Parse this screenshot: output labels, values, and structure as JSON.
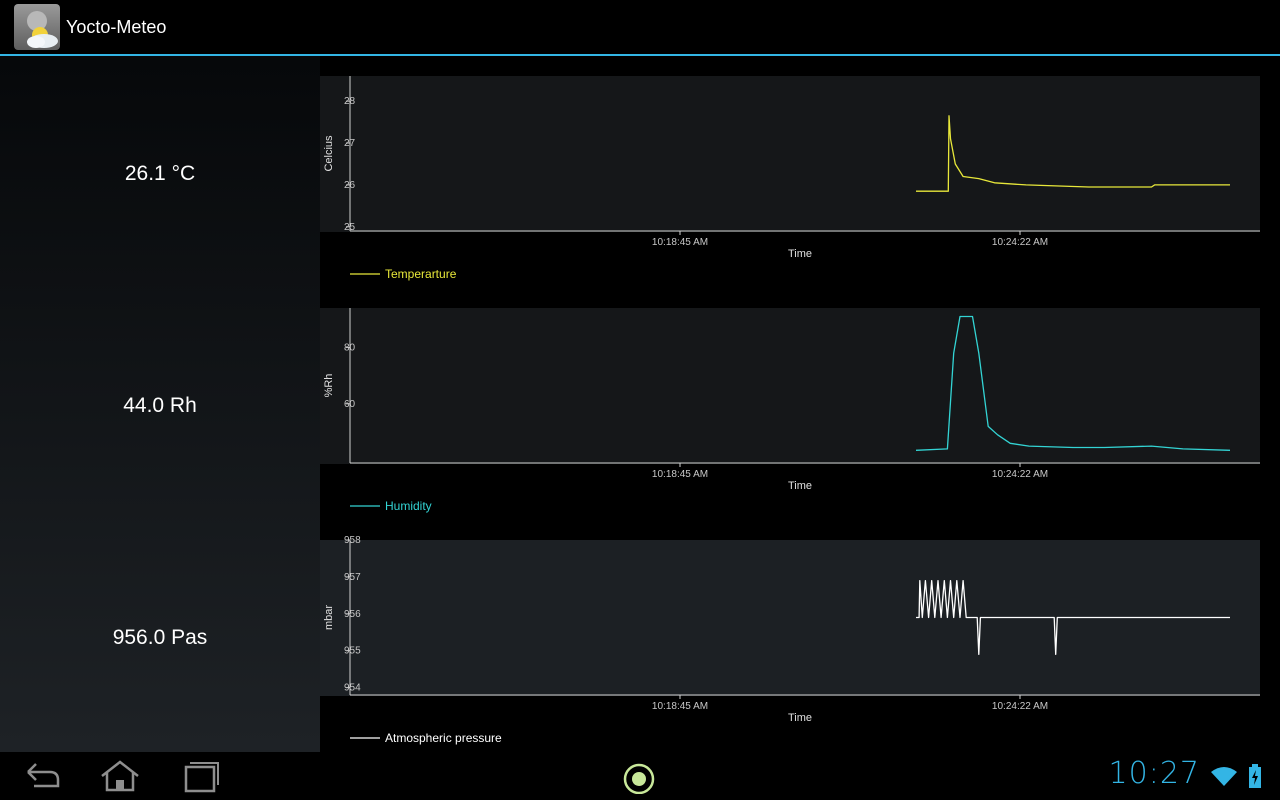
{
  "app": {
    "title": "Yocto-Meteo"
  },
  "readings": [
    {
      "value": "26.1 °C"
    },
    {
      "value": "44.0 Rh"
    },
    {
      "value": "956.0 Pas"
    }
  ],
  "charts": [
    {
      "id": "temperature",
      "ylabel": "Celcius",
      "xlabel": "Time",
      "legend": "Temperarture",
      "color": "#e8e83a",
      "yticks": [
        "28",
        "27",
        "26",
        "25"
      ],
      "xticks": [
        "10:18:45 AM",
        "10:24:22 AM"
      ]
    },
    {
      "id": "humidity",
      "ylabel": "%Rh",
      "xlabel": "Time",
      "legend": "Humidity",
      "color": "#33d4d4",
      "yticks": [
        "80",
        "60"
      ],
      "xticks": [
        "10:18:45 AM",
        "10:24:22 AM"
      ]
    },
    {
      "id": "pressure",
      "ylabel": "mbar",
      "xlabel": "Time",
      "legend": "Atmospheric pressure",
      "color": "#ffffff",
      "yticks": [
        "958",
        "957",
        "956",
        "955",
        "954"
      ],
      "xticks": [
        "10:18:45 AM",
        "10:24:22 AM"
      ]
    }
  ],
  "chart_data": [
    {
      "type": "line",
      "ylabel": "Celcius",
      "xlabel": "Time",
      "ylim": [
        24.9,
        28.6
      ],
      "series": [
        {
          "name": "Temperarture",
          "points": [
            [
              0,
              25.85
            ],
            [
              0.103,
              25.85
            ],
            [
              0.105,
              27.65
            ],
            [
              0.11,
              27.1
            ],
            [
              0.125,
              26.5
            ],
            [
              0.15,
              26.2
            ],
            [
              0.2,
              26.15
            ],
            [
              0.25,
              26.05
            ],
            [
              0.35,
              26.0
            ],
            [
              0.55,
              25.95
            ],
            [
              0.75,
              25.95
            ],
            [
              0.76,
              26.0
            ],
            [
              1,
              26.0
            ]
          ]
        }
      ],
      "xticks": [
        "10:18:45 AM",
        "10:24:22 AM"
      ]
    },
    {
      "type": "line",
      "ylabel": "%Rh",
      "xlabel": "Time",
      "ylim": [
        39,
        94
      ],
      "series": [
        {
          "name": "Humidity",
          "points": [
            [
              0,
              43.5
            ],
            [
              0.1,
              44
            ],
            [
              0.12,
              78
            ],
            [
              0.14,
              91
            ],
            [
              0.18,
              91
            ],
            [
              0.2,
              78
            ],
            [
              0.23,
              52
            ],
            [
              0.26,
              49
            ],
            [
              0.3,
              46
            ],
            [
              0.36,
              45
            ],
            [
              0.5,
              44.5
            ],
            [
              0.6,
              44.5
            ],
            [
              0.75,
              45
            ],
            [
              0.85,
              44
            ],
            [
              1,
              43.5
            ]
          ]
        }
      ],
      "xticks": [
        "10:18:45 AM",
        "10:24:22 AM"
      ]
    },
    {
      "type": "line",
      "ylabel": "mbar",
      "xlabel": "Time",
      "ylim": [
        953.8,
        958.0
      ],
      "series": [
        {
          "name": "Atmospheric pressure",
          "points": [
            [
              0,
              955.9
            ],
            [
              0.01,
              955.9
            ],
            [
              0.012,
              956.9
            ],
            [
              0.02,
              955.9
            ],
            [
              0.03,
              956.9
            ],
            [
              0.04,
              955.9
            ],
            [
              0.05,
              956.9
            ],
            [
              0.06,
              955.9
            ],
            [
              0.07,
              956.9
            ],
            [
              0.08,
              955.9
            ],
            [
              0.09,
              956.9
            ],
            [
              0.1,
              955.9
            ],
            [
              0.11,
              956.9
            ],
            [
              0.12,
              955.9
            ],
            [
              0.13,
              956.9
            ],
            [
              0.14,
              955.9
            ],
            [
              0.15,
              956.9
            ],
            [
              0.16,
              955.9
            ],
            [
              0.195,
              955.9
            ],
            [
              0.2,
              954.9
            ],
            [
              0.205,
              955.9
            ],
            [
              0.44,
              955.9
            ],
            [
              0.445,
              954.9
            ],
            [
              0.45,
              955.9
            ],
            [
              1,
              955.9
            ]
          ]
        }
      ],
      "xticks": [
        "10:18:45 AM",
        "10:24:22 AM"
      ]
    }
  ],
  "status": {
    "clock": "10:27"
  },
  "icons": {
    "back": "back-arrow-icon",
    "home": "home-icon",
    "recents": "recent-apps-icon",
    "center": "target-icon",
    "wifi": "wifi-icon",
    "battery": "battery-charging-icon"
  }
}
